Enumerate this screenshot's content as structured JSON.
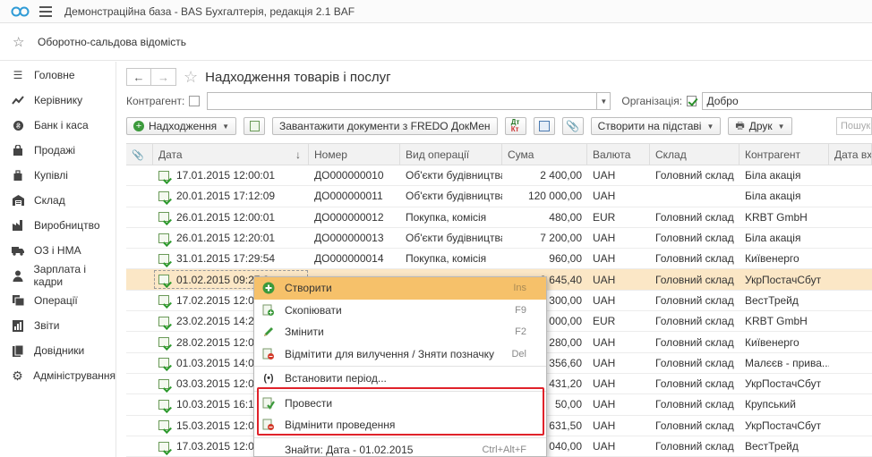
{
  "app": {
    "title": "Демонстраційна база - BAS Бухгалтерія, редакція 2.1 BAF"
  },
  "favorites": {
    "link": "Оборотно-сальдова відомість"
  },
  "sidebar": {
    "items": [
      {
        "label": "Головне",
        "icon": "menu-lines-icon"
      },
      {
        "label": "Керівнику",
        "icon": "trend-icon"
      },
      {
        "label": "Банк і каса",
        "icon": "coin-icon"
      },
      {
        "label": "Продажі",
        "icon": "bag-icon"
      },
      {
        "label": "Купівлі",
        "icon": "cart-icon"
      },
      {
        "label": "Склад",
        "icon": "warehouse-icon"
      },
      {
        "label": "Виробництво",
        "icon": "factory-icon"
      },
      {
        "label": "ОЗ і НМА",
        "icon": "truck-icon"
      },
      {
        "label": "Зарплата і кадри",
        "icon": "person-icon"
      },
      {
        "label": "Операції",
        "icon": "operations-icon"
      },
      {
        "label": "Звіти",
        "icon": "bar-chart-icon"
      },
      {
        "label": "Довідники",
        "icon": "book-icon"
      },
      {
        "label": "Адміністрування",
        "icon": "gear-icon"
      }
    ]
  },
  "page": {
    "title": "Надходження товарів і послуг"
  },
  "filters": {
    "counterparty_label": "Контрагент:",
    "counterparty_value": "",
    "org_label": "Організація:",
    "org_value": "Добро"
  },
  "toolbar": {
    "receipt_label": "Надходження",
    "fredo_label": "Завантажити документи з FREDO ДокМен",
    "create_based_label": "Створити на підставі",
    "print_label": "Друк",
    "search_placeholder": "Пошук"
  },
  "table": {
    "columns": [
      "Дата",
      "Номер",
      "Вид операції",
      "Сума",
      "Валюта",
      "Склад",
      "Контрагент",
      "Дата вх."
    ],
    "rows": [
      {
        "date": "17.01.2015 12:00:01",
        "number": "ДО000000010",
        "op": "Об'єкти будівництва",
        "sum": "2 400,00",
        "cur": "UAH",
        "warehouse": "Головний склад",
        "counterparty": "Біла акація"
      },
      {
        "date": "20.01.2015 17:12:09",
        "number": "ДО000000011",
        "op": "Об'єкти будівництва",
        "sum": "120 000,00",
        "cur": "UAH",
        "warehouse": "",
        "counterparty": "Біла акація"
      },
      {
        "date": "26.01.2015 12:00:01",
        "number": "ДО000000012",
        "op": "Покупка, комісія",
        "sum": "480,00",
        "cur": "EUR",
        "warehouse": "Головний склад",
        "counterparty": "KRBT GmbH"
      },
      {
        "date": "26.01.2015 12:20:01",
        "number": "ДО000000013",
        "op": "Об'єкти будівництва",
        "sum": "7 200,00",
        "cur": "UAH",
        "warehouse": "Головний склад",
        "counterparty": "Біла акація"
      },
      {
        "date": "31.01.2015 17:29:54",
        "number": "ДО000000014",
        "op": "Покупка, комісія",
        "sum": "960,00",
        "cur": "UAH",
        "warehouse": "Головний склад",
        "counterparty": "Київенерго"
      },
      {
        "date": "01.02.2015 09:27:0",
        "number": "",
        "op": "",
        "sum": "3 645,40",
        "cur": "UAH",
        "warehouse": "Головний склад",
        "counterparty": "УкрПостачСбут"
      },
      {
        "date": "17.02.2015 12:00",
        "number": "",
        "op": "",
        "sum": "5 300,00",
        "cur": "UAH",
        "warehouse": "Головний склад",
        "counterparty": "ВестТрейд"
      },
      {
        "date": "23.02.2015 14:28",
        "number": "",
        "op": "",
        "sum": "1 000,00",
        "cur": "EUR",
        "warehouse": "Головний склад",
        "counterparty": "KRBT GmbH"
      },
      {
        "date": "28.02.2015 12:00",
        "number": "",
        "op": "",
        "sum": "1 280,00",
        "cur": "UAH",
        "warehouse": "Головний склад",
        "counterparty": "Київенерго"
      },
      {
        "date": "01.03.2015 14:00",
        "number": "",
        "op": "",
        "sum": "356,60",
        "cur": "UAH",
        "warehouse": "Головний склад",
        "counterparty": "Малєєв - прива..."
      },
      {
        "date": "03.03.2015 12:00",
        "number": "",
        "op": "",
        "sum": "2 431,20",
        "cur": "UAH",
        "warehouse": "Головний склад",
        "counterparty": "УкрПостачСбут"
      },
      {
        "date": "10.03.2015 16:16",
        "number": "",
        "op": "",
        "sum": "50,00",
        "cur": "UAH",
        "warehouse": "Головний склад",
        "counterparty": "Крупський"
      },
      {
        "date": "15.03.2015 12:00",
        "number": "",
        "op": "",
        "sum": "3 631,50",
        "cur": "UAH",
        "warehouse": "Головний склад",
        "counterparty": "УкрПостачСбут"
      },
      {
        "date": "17.03.2015 12:00",
        "number": "",
        "op": "",
        "sum": "4 040,00",
        "cur": "UAH",
        "warehouse": "Головний склад",
        "counterparty": "ВестТрейд"
      }
    ]
  },
  "context_menu": {
    "items": [
      {
        "label": "Створити",
        "key": "Ins",
        "icon": "plus-circle-icon"
      },
      {
        "label": "Скопіювати",
        "key": "F9",
        "icon": "copy-icon"
      },
      {
        "label": "Змінити",
        "key": "F2",
        "icon": "pencil-icon"
      },
      {
        "label": "Відмітити для вилучення / Зняти позначку",
        "key": "Del",
        "icon": "delete-mark-icon"
      },
      {
        "label": "Встановити період...",
        "key": "",
        "icon": "period-icon"
      },
      {
        "label": "Провести",
        "key": "",
        "icon": "post-icon"
      },
      {
        "label": "Відмінити проведення",
        "key": "",
        "icon": "unpost-icon"
      },
      {
        "label": "Знайти: Дата - 01.02.2015",
        "key": "Ctrl+Alt+F",
        "icon": ""
      }
    ]
  },
  "colors": {
    "highlight": "#f6c16a",
    "selected_row": "#fbe7c6",
    "annotation": "#e0222a"
  }
}
